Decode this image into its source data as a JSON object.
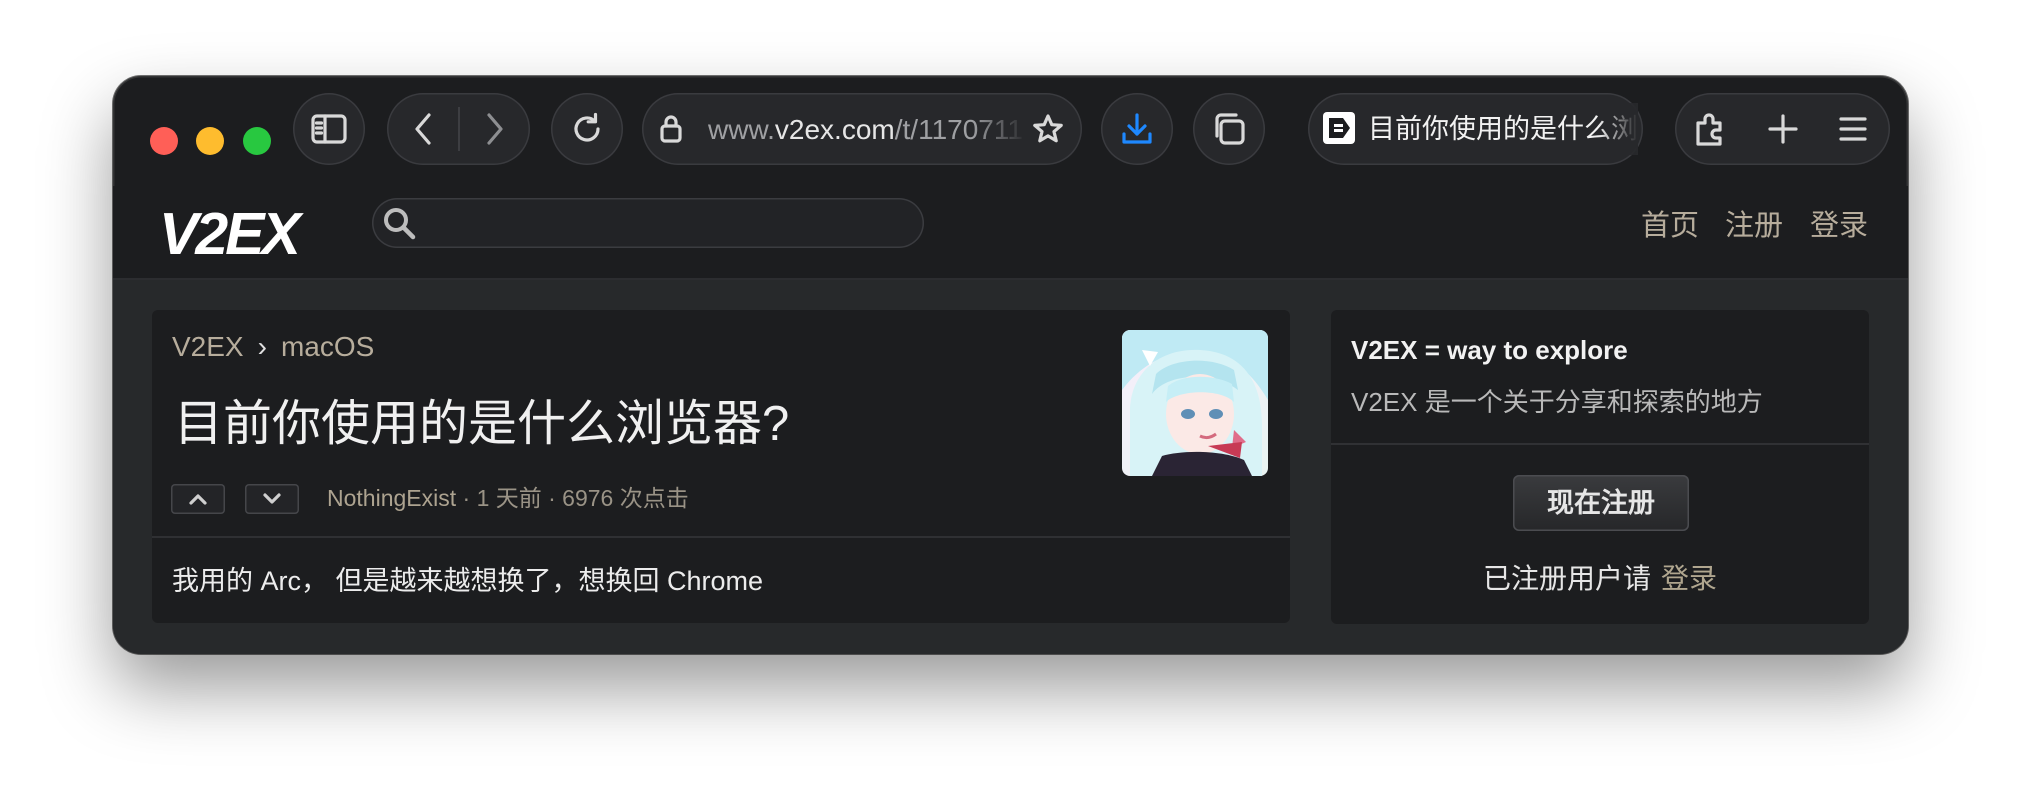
{
  "browser": {
    "url_prefix": "www.",
    "url_domain": "v2ex.com",
    "url_path": "/t/1170711",
    "tab_title": "目前你使用的是什么浏览器?"
  },
  "header": {
    "logo": "V2EX",
    "search_placeholder": "",
    "nav": {
      "home": "首页",
      "register": "注册",
      "login": "登录"
    }
  },
  "topic": {
    "breadcrumb_root": "V2EX",
    "breadcrumb_sep": "›",
    "breadcrumb_node": "macOS",
    "title": "目前你使用的是什么浏览器?",
    "author": "NothingExist",
    "meta_rest": " · 1 天前 · 6976 次点击",
    "content": "我用的 Arc， 但是越来越想换了，想换回 Chrome"
  },
  "sidebar": {
    "heading": "V2EX = way to explore",
    "tagline": "V2EX 是一个关于分享和探索的地方",
    "register_button": "现在注册",
    "login_prompt": "已注册用户请",
    "login_link": "登录"
  },
  "icons": {
    "toolbar": [
      "sidebar-icon",
      "back-icon",
      "forward-icon",
      "reload-icon",
      "lock-icon",
      "star-icon",
      "download-icon",
      "tabs-icon",
      "extensions-icon",
      "new-tab-icon",
      "menu-icon"
    ],
    "content": [
      "search-icon",
      "upvote-icon",
      "downvote-icon"
    ]
  },
  "colors": {
    "accent_download": "#1e88ff",
    "link": "#b7ad9c",
    "traffic_red": "#ff5f57",
    "traffic_yellow": "#febc2e",
    "traffic_green": "#28c840"
  }
}
